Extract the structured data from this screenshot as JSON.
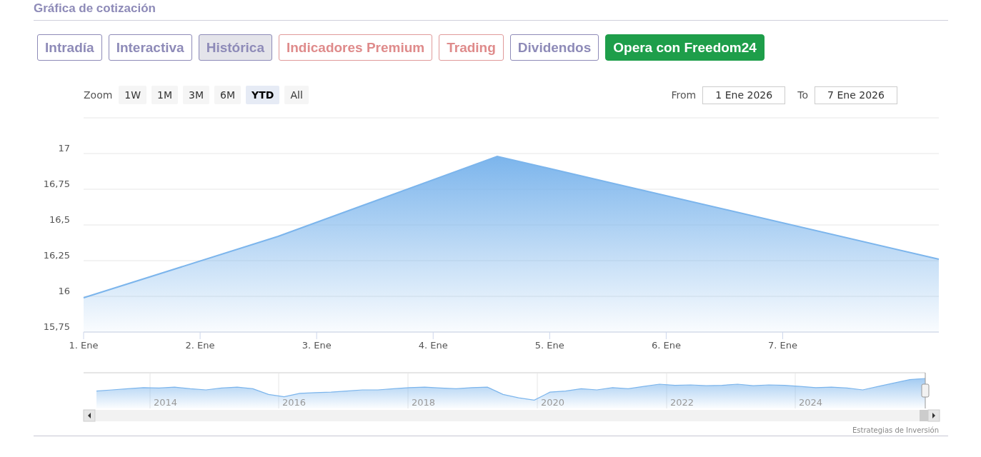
{
  "section_title": "Gráfica de cotización",
  "tabs": [
    {
      "label": "Intradía",
      "kind": "tab",
      "selected": false
    },
    {
      "label": "Interactiva",
      "kind": "tab",
      "selected": false
    },
    {
      "label": "Histórica",
      "kind": "tab",
      "selected": true
    },
    {
      "label": "Indicadores Premium",
      "kind": "premium",
      "selected": false
    },
    {
      "label": "Trading",
      "kind": "premium",
      "selected": false
    },
    {
      "label": "Dividendos",
      "kind": "tab",
      "selected": false
    },
    {
      "label": "Opera con Freedom24",
      "kind": "cta",
      "selected": false
    }
  ],
  "zoom": {
    "label": "Zoom",
    "buttons": [
      {
        "label": "1W",
        "selected": false
      },
      {
        "label": "1M",
        "selected": false
      },
      {
        "label": "3M",
        "selected": false
      },
      {
        "label": "6M",
        "selected": false
      },
      {
        "label": "YTD",
        "selected": true
      },
      {
        "label": "All",
        "selected": false
      }
    ]
  },
  "range": {
    "from_label": "From",
    "from": "1 Ene 2026",
    "to_label": "To",
    "to": "7 Ene 2026"
  },
  "chart_data": {
    "type": "area",
    "grid": true,
    "xlim": [
      1,
      8.34
    ],
    "ylim": [
      15.75,
      17.25
    ],
    "xticks": [
      {
        "value": 1,
        "label": "1. Ene"
      },
      {
        "value": 2,
        "label": "2. Ene"
      },
      {
        "value": 3,
        "label": "3. Ene"
      },
      {
        "value": 4,
        "label": "4. Ene"
      },
      {
        "value": 5,
        "label": "5. Ene"
      },
      {
        "value": 6,
        "label": "6. Ene"
      },
      {
        "value": 7,
        "label": "7. Ene"
      }
    ],
    "yticks": [
      {
        "value": 15.75,
        "label": "15,75"
      },
      {
        "value": 16,
        "label": "16"
      },
      {
        "value": 16.25,
        "label": "16,25"
      },
      {
        "value": 16.5,
        "label": "16,5"
      },
      {
        "value": 16.75,
        "label": "16,75"
      },
      {
        "value": 17,
        "label": "17"
      }
    ],
    "x": [
      1,
      2.67,
      4.55,
      8.34
    ],
    "series": [
      {
        "color": "#7cb5ec",
        "values": [
          15.99,
          16.42,
          16.98,
          16.26
        ]
      }
    ]
  },
  "navigator": {
    "years": [
      "2014",
      "2016",
      "2018",
      "2020",
      "2022",
      "2024"
    ]
  },
  "credits": "Estrategias de Inversión"
}
